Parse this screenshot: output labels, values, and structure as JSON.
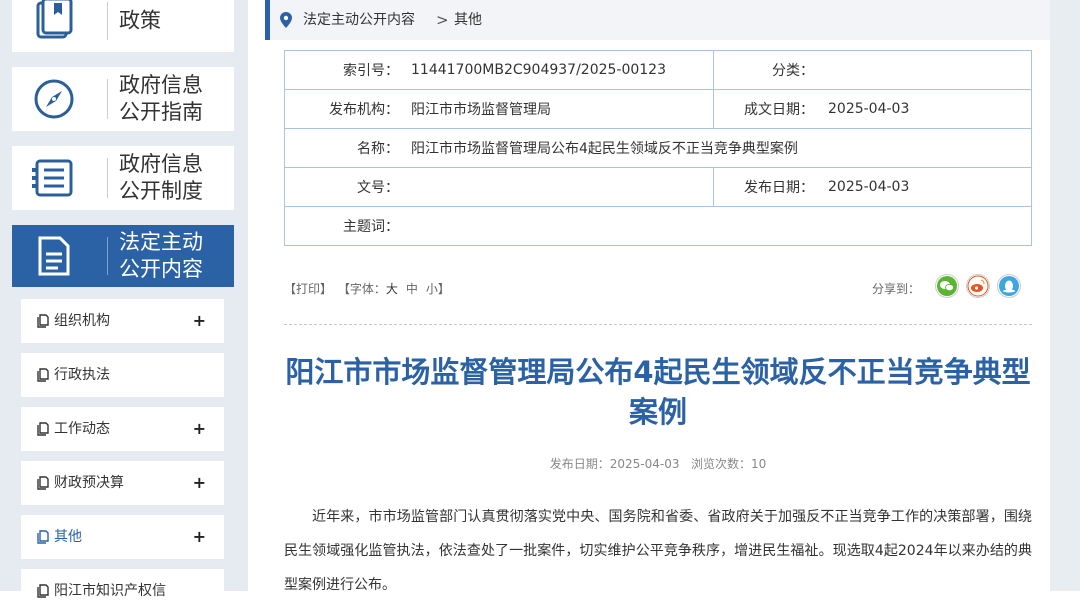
{
  "sidebar": {
    "tiles": [
      {
        "label": "政策"
      },
      {
        "label": "政府信息\n公开指南"
      },
      {
        "label": "政府信息\n公开制度"
      },
      {
        "label": "法定主动\n公开内容"
      }
    ],
    "subitems": [
      {
        "label": "组织机构",
        "expand": "+"
      },
      {
        "label": "行政执法",
        "expand": ""
      },
      {
        "label": "工作动态",
        "expand": "+"
      },
      {
        "label": "财政预决算",
        "expand": "+"
      },
      {
        "label": "其他",
        "expand": "+"
      },
      {
        "label": "阳江市知识产权信",
        "expand": ""
      }
    ]
  },
  "breadcrumb": {
    "level1": "法定主动公开内容",
    "separator": ">",
    "level2": "其他"
  },
  "meta": {
    "index_label": "索引号：",
    "index_value": "11441700MB2C904937/2025-00123",
    "category_label": "分类：",
    "category_value": "",
    "publisher_label": "发布机构：",
    "publisher_value": "阳江市市场监督管理局",
    "created_label": "成文日期：",
    "created_value": "2025-04-03",
    "name_label": "名称：",
    "name_value": "阳江市市场监督管理局公布4起民生领域反不正当竞争典型案例",
    "docno_label": "文号：",
    "docno_value": "",
    "pubdate_label": "发布日期：",
    "pubdate_value": "2025-04-03",
    "subject_label": "主题词：",
    "subject_value": ""
  },
  "toolbar": {
    "print": "【打印】",
    "font_label": "【字体：",
    "font_large": "大",
    "font_medium": "中",
    "font_small": "小】",
    "share_label": "分享到："
  },
  "article": {
    "title": "阳江市市场监督管理局公布4起民生领域反不正当竞争典型案例",
    "meta_line": "发布日期：2025-04-03   浏览次数：10",
    "body": "近年来，市市场监管部门认真贯彻落实党中央、国务院和省委、省政府关于加强反不正当竞争工作的决策部署，围绕民生领域强化监管执法，依法查处了一批案件，切实维护公平竞争秩序，增进民生福祉。现选取4起2024年以来办结的典型案例进行公布。"
  },
  "colors": {
    "accent": "#2b62a6",
    "wechat": "#5cb531",
    "weibo": "#e8541e",
    "qq": "#3ea6e0"
  }
}
